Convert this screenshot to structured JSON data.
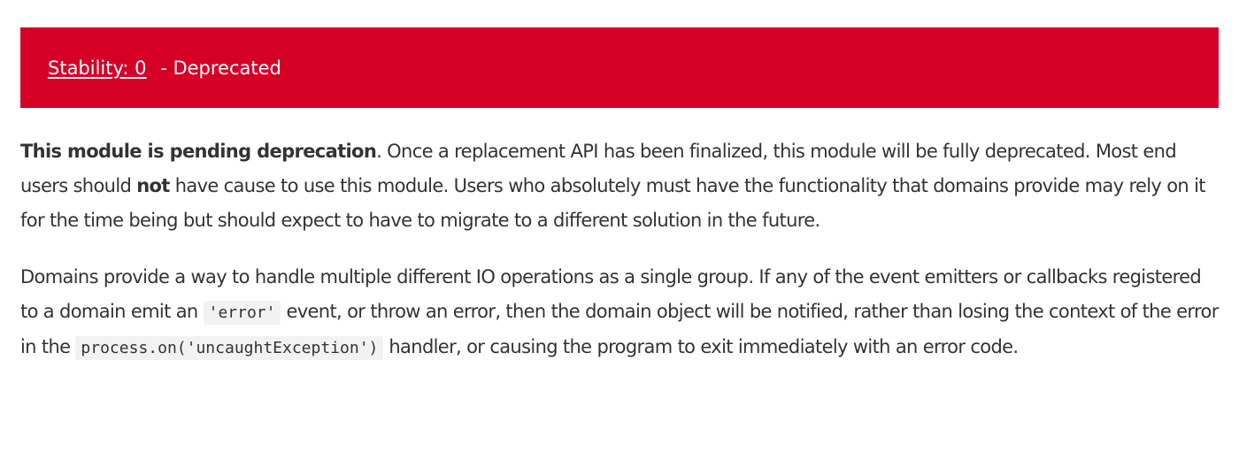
{
  "banner": {
    "link_label": "Stability: 0",
    "separator_text": " - Deprecated",
    "background_color": "#d60027",
    "text_color": "#ffffff"
  },
  "paragraph1": {
    "bold_lead": "This module is pending deprecation",
    "text_a": ". Once a replacement API has been finalized, this module will be fully deprecated. Most end users should ",
    "bold_not": "not",
    "text_b": " have cause to use this module. Users who absolutely must have the functionality that domains provide may rely on it for the time being but should expect to have to migrate to a different solution in the future."
  },
  "paragraph2": {
    "text_a": "Domains provide a way to handle multiple different IO operations as a single group. If any of the event emitters or callbacks registered to a domain emit an ",
    "code_error": "'error'",
    "text_b": " event, or throw an error, then the domain object will be notified, rather than losing the context of the error in the ",
    "code_process": "process.on('uncaughtException')",
    "text_c": " handler, or causing the program to exit immediately with an error code."
  },
  "colors": {
    "body_text": "#333333",
    "code_background": "#f2f2f2"
  }
}
